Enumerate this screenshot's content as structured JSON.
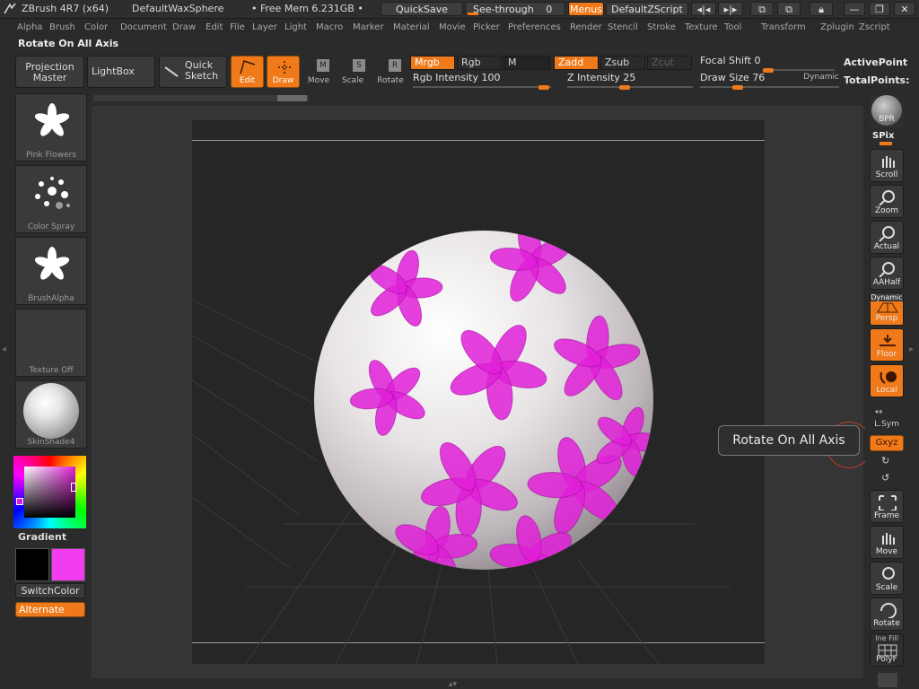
{
  "titlebar": {
    "app_title": "ZBrush 4R7 (x64)",
    "document_name": "DefaultWaxSphere",
    "free_mem": "• Free Mem 6.231GB •",
    "quicksave": "QuickSave",
    "see_through_label": "See-through",
    "see_through_value": "0",
    "menus": "Menus",
    "default_zscript": "DefaultZScript"
  },
  "menubar": [
    "Alpha",
    "Brush",
    "Color",
    "Document",
    "Draw",
    "Edit",
    "File",
    "Layer",
    "Light",
    "Macro",
    "Marker",
    "Material",
    "Movie",
    "Picker",
    "Preferences",
    "Render",
    "Stencil",
    "Stroke",
    "Texture",
    "Tool",
    "Transform",
    "Zplugin",
    "Zscript"
  ],
  "info_text": "Rotate On All Axis",
  "toolbar": {
    "projection_master": "Projection Master",
    "lightbox": "LightBox",
    "quick_sketch": "Quick Sketch",
    "edit": "Edit",
    "draw": "Draw",
    "move": "Move",
    "scale": "Scale",
    "rotate": "Rotate",
    "mrgb": "Mrgb",
    "rgb": "Rgb",
    "m": "M",
    "zadd": "Zadd",
    "zsub": "Zsub",
    "zcut": "Zcut",
    "rgb_intensity_label": "Rgb Intensity",
    "rgb_intensity_value": "100",
    "z_intensity_label": "Z Intensity",
    "z_intensity_value": "25",
    "focal_shift_label": "Focal Shift",
    "focal_shift_value": "0",
    "draw_size_label": "Draw Size",
    "draw_size_value": "76",
    "dynamic": "Dynamic",
    "active_points": "ActivePoint",
    "total_points": "TotalPoints:"
  },
  "left_shelf": {
    "brush_alpha_1": "Pink Flowers",
    "stroke": "Color Spray",
    "alpha": "BrushAlpha",
    "texture": "Texture Off",
    "material": "SkinShade4",
    "gradient": "Gradient",
    "switch_color": "SwitchColor",
    "alternate": "Alternate",
    "main_color": "#000000",
    "secondary_color": "#f23cf0"
  },
  "right_shelf": {
    "bpr": "BPR",
    "spix": "SPix",
    "scroll": "Scroll",
    "zoom": "Zoom",
    "actual": "Actual",
    "aahalf": "AAHalf",
    "dynamic": "Dynamic",
    "persp": "Persp",
    "floor": "Floor",
    "local": "Local",
    "lsym": "L.Sym",
    "xyz": "Gxyz",
    "frame": "Frame",
    "move": "Move",
    "scale": "Scale",
    "rotate": "Rotate",
    "line_fill": "Ine Fill",
    "polyf": "PolyF"
  },
  "tooltip": "Rotate On All Axis",
  "colors": {
    "accent": "#f07a1a",
    "paint": "#e020d8"
  }
}
